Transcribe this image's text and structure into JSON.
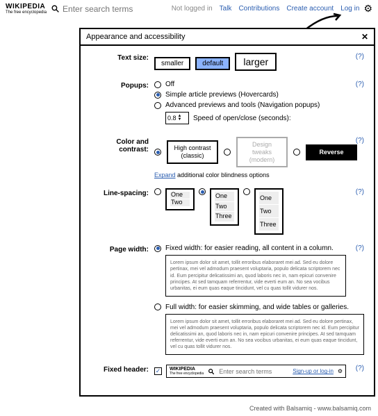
{
  "header": {
    "logo_main": "WIKIPEDIA",
    "logo_sub": "The free encyclopedia",
    "search_placeholder": "Enter search terms",
    "links": {
      "not_logged_in": "Not logged in",
      "talk": "Talk",
      "contributions": "Contributions",
      "create_account": "Create account",
      "log_in": "Log in"
    }
  },
  "panel": {
    "title": "Appearance and accessibility",
    "help": "(?)",
    "text_size": {
      "label": "Text size:",
      "smaller": "smaller",
      "default": "default",
      "larger": "larger"
    },
    "popups": {
      "label": "Popups:",
      "off": "Off",
      "simple": "Simple article previews (Hovercards)",
      "advanced": "Advanced previews and tools (Navigation popups)",
      "speed_value": "0.8",
      "speed_label": "Speed of open/close (seconds):"
    },
    "color": {
      "label": "Color and contrast:",
      "high_contrast_1": "High contrast",
      "high_contrast_2": "(classic)",
      "design_1": "Design tweaks",
      "design_2": "(modern)",
      "reverse": "Reverse",
      "expand": "Expand",
      "expand_rest": " additional color blindness options"
    },
    "line_spacing": {
      "label": "Line-spacing:",
      "one": "One",
      "two": "Two",
      "three": "Three"
    },
    "page_width": {
      "label": "Page width:",
      "fixed": "Fixed width: for easier reading, all content in a column.",
      "full": "Full width: for easier skimming, and wide tables or galleries.",
      "lorem": "Lorem ipsum dolor sit amet, tollit erroribus elaboraret mei ad. Sed eu dolore pertinax, mei vel admodum praesent voluptaria, populo delicata scriptorem nec id. Eum percipitur delicatissimi an, quod laboris nec in, nam epicuri convenire principes. At sed tamquam referrentur, vide everti eum an. No sea vocibus urbanitas, ei eum quas eaque tincidunt, vel cu quas tollit vidurer nos."
    },
    "fixed_header": {
      "label": "Fixed header:",
      "logo_main": "WIKIPEDIA",
      "logo_sub": "The free encyclopedia",
      "search_placeholder": "Enter search terms",
      "signin": "Sign-up or log-in"
    }
  },
  "footer": "Created with Balsamiq - www.balsamiq.com"
}
